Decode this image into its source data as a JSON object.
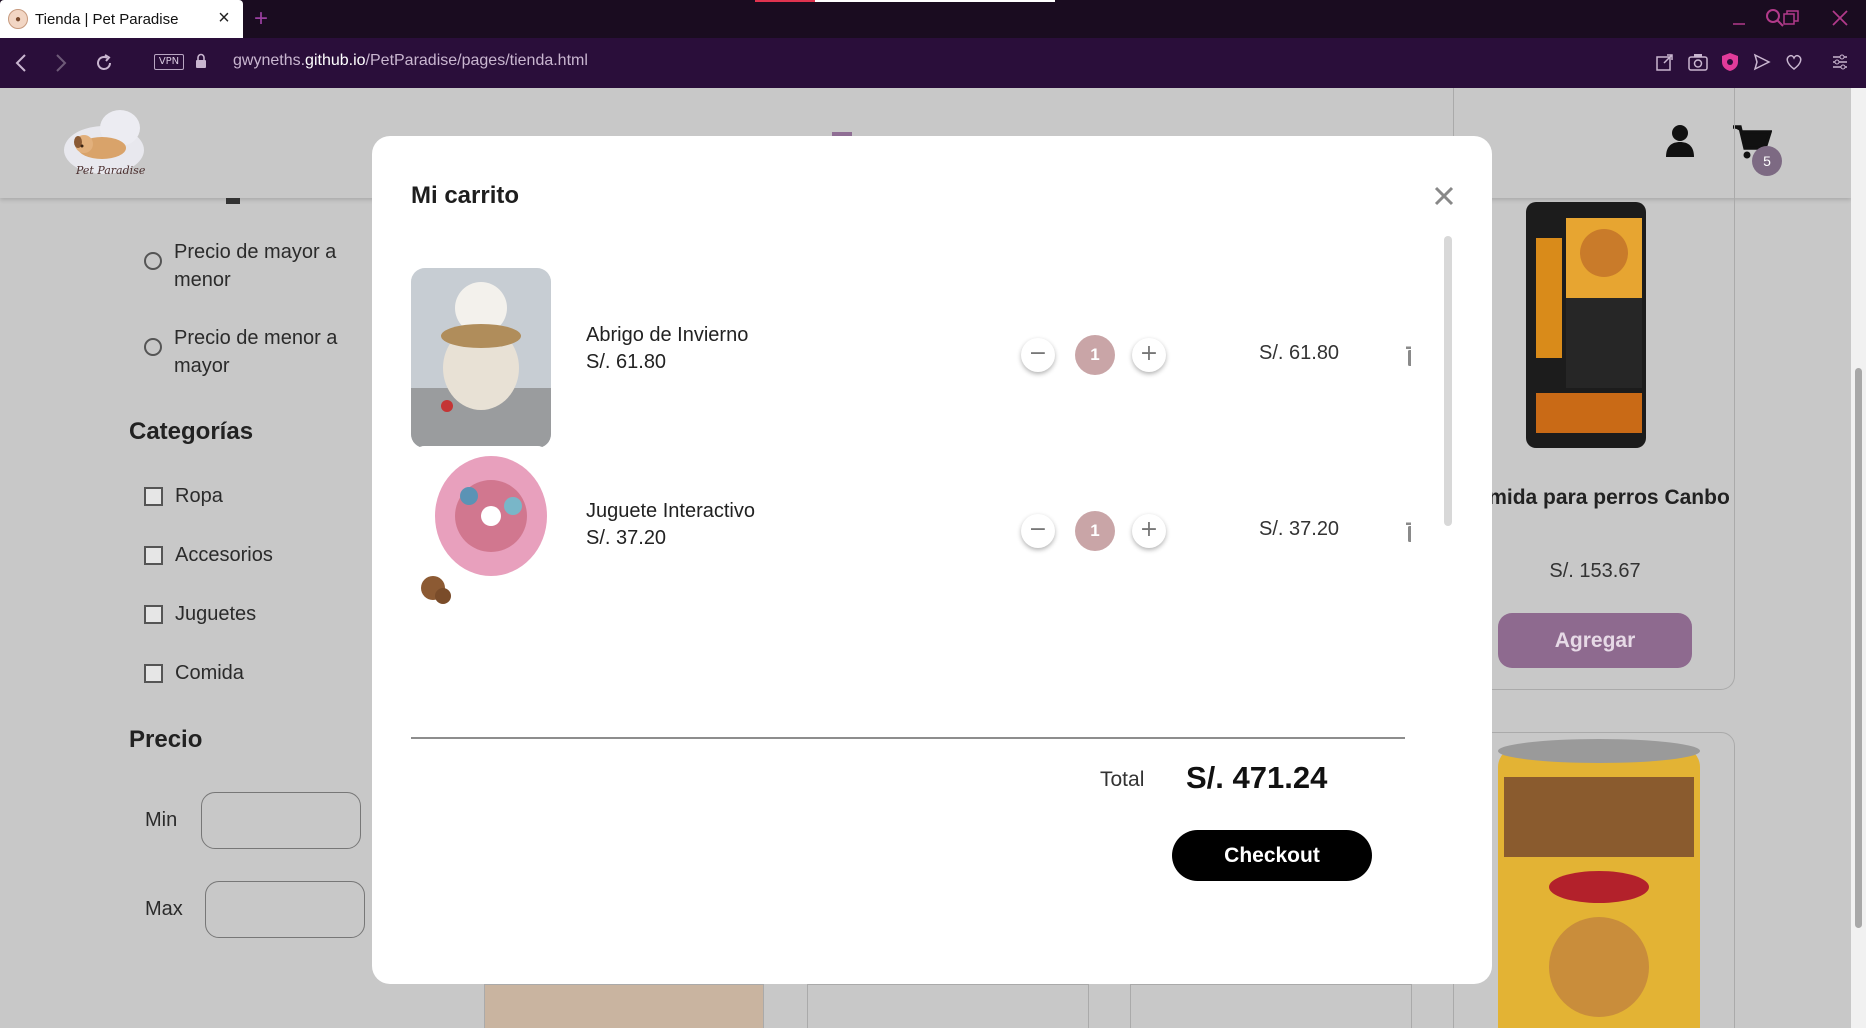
{
  "browser": {
    "tab_title": "Tienda | Pet Paradise",
    "new_tab_symbol": "+",
    "vpn_label": "VPN",
    "url_prefix": "gwyneths.",
    "url_domain": "github.io",
    "url_path": "/PetParadise/pages/tienda.html",
    "icons": [
      "back-icon",
      "forward-icon",
      "reload-icon",
      "lock-icon",
      "share-icon",
      "camera-icon",
      "shield-icon",
      "send-icon",
      "heart-icon",
      "settings-icon",
      "search-icon",
      "minimize-icon",
      "restore-icon",
      "close-icon"
    ]
  },
  "header": {
    "logo_text": "Pet Paradise",
    "cart_count": "5"
  },
  "sidebar": {
    "sort_options": [
      "Precio de mayor a menor",
      "Precio de menor a mayor"
    ],
    "categories_title": "Categorías",
    "categories": [
      "Ropa",
      "Accesorios",
      "Juguetes",
      "Comida"
    ],
    "price_title": "Precio",
    "min_label": "Min",
    "max_label": "Max"
  },
  "product": {
    "name": "Comida para perros Canbo",
    "price": "S/. 153.67",
    "add_label": "Agregar"
  },
  "modal": {
    "title": "Mi carrito",
    "items": [
      {
        "name": "Abrigo de Invierno",
        "unit_price": "S/. 61.80",
        "quantity": "1",
        "total": "S/. 61.80"
      },
      {
        "name": "Juguete Interactivo",
        "unit_price": "S/. 37.20",
        "quantity": "1",
        "total": "S/. 37.20"
      }
    ],
    "total_label": "Total",
    "total_value": "S/. 471.24",
    "checkout_label": "Checkout"
  },
  "colors": {
    "accent": "#8e6a8f",
    "qty_bubble": "#c9a5a7",
    "browser_bar": "#2a0e3a"
  }
}
